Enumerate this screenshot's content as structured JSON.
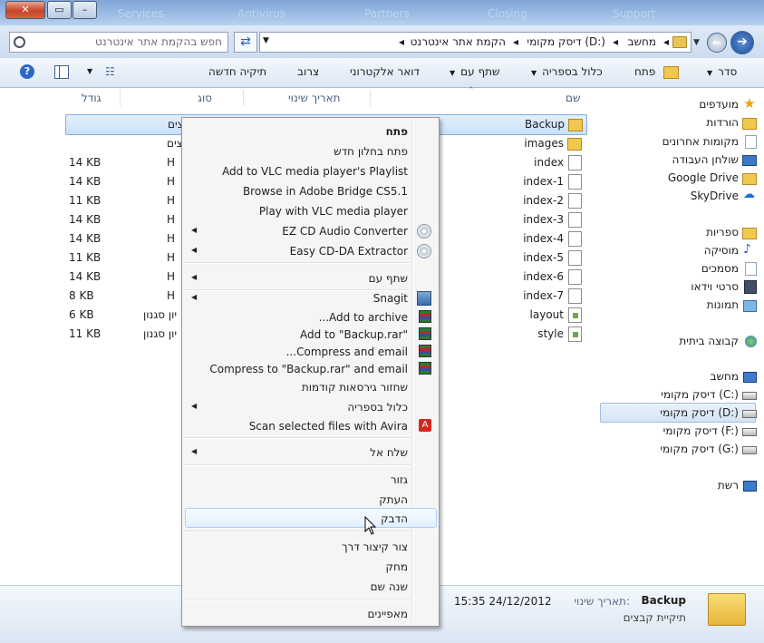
{
  "titlebar": {
    "ghost_tabs": [
      "Services",
      "Antivirus",
      "Partners",
      "Closing",
      "Support"
    ]
  },
  "nav": {
    "breadcrumbs": [
      "מחשב",
      "דיסק מקומי (D:)",
      "הקמת אתר אינטרנט"
    ],
    "search_placeholder": "חפש בהקמת אתר אינטרנט"
  },
  "toolbar": {
    "organize": "סדר",
    "open": "פתח",
    "include_library": "כלול בספריה",
    "share_with": "שתף עם",
    "email": "דואר אלקטרוני",
    "burn": "צרוב",
    "new_folder": "תיקיה חדשה"
  },
  "columns": {
    "name": "שם",
    "date_modified": "תאריך שינוי",
    "type": "סוג",
    "size": "גודל"
  },
  "files": [
    {
      "name": "Backup",
      "icon": "folder",
      "type": "צים",
      "size": ""
    },
    {
      "name": "images",
      "icon": "folder",
      "type": "צים",
      "size": ""
    },
    {
      "name": "index",
      "icon": "file",
      "type": "H",
      "size": "14 KB"
    },
    {
      "name": "index-1",
      "icon": "file",
      "type": "H",
      "size": "14 KB"
    },
    {
      "name": "index-2",
      "icon": "file",
      "type": "H",
      "size": "11 KB"
    },
    {
      "name": "index-3",
      "icon": "file",
      "type": "H",
      "size": "14 KB"
    },
    {
      "name": "index-4",
      "icon": "file",
      "type": "H",
      "size": "14 KB"
    },
    {
      "name": "index-5",
      "icon": "file",
      "type": "H",
      "size": "11 KB"
    },
    {
      "name": "index-6",
      "icon": "file",
      "type": "H",
      "size": "14 KB"
    },
    {
      "name": "index-7",
      "icon": "file",
      "type": "H",
      "size": "8 KB"
    },
    {
      "name": "layout",
      "icon": "css",
      "type": "יון סגנון",
      "size": "6 KB"
    },
    {
      "name": "style",
      "icon": "css",
      "type": "יון סגנון",
      "size": "11 KB"
    }
  ],
  "navpane": {
    "favorites": "מועדפים",
    "downloads": "הורדות",
    "recent_places": "מקומות אחרונים",
    "desktop": "שולחן העבודה",
    "google_drive": "Google Drive",
    "skydrive": "SkyDrive",
    "libraries": "ספריות",
    "music": "מוסיקה",
    "documents": "מסמכים",
    "videos": "סרטי וידאו",
    "pictures": "תמונות",
    "homegroup": "קבוצה ביתית",
    "computer": "מחשב",
    "drive_c": "דיסק מקומי (C:)",
    "drive_d": "דיסק מקומי (D:)",
    "drive_f": "דיסק מקומי (F:)",
    "drive_g": "דיסק מקומי (G:)",
    "network": "רשת"
  },
  "details": {
    "name": "Backup",
    "kind": "תיקיית קבצים",
    "modified_label": "תאריך שינוי:",
    "modified_value": "15:35 24/12/2012"
  },
  "context_menu": {
    "open": "פתח",
    "open_new_window": "פתח בחלון חדש",
    "vlc_playlist": "Add to VLC media player's Playlist",
    "adobe_bridge": "Browse in Adobe Bridge CS5.1",
    "vlc_play": "Play with VLC media player",
    "ez_cd": "EZ CD Audio Converter",
    "easy_cd": "Easy CD-DA Extractor",
    "share_with": "שתף עם",
    "snagit": "Snagit",
    "add_archive": "...Add to archive",
    "add_backup_rar": "Add to \"Backup.rar\"",
    "compress_email": "...Compress and email",
    "compress_backup_email": "Compress to \"Backup.rar\" and email",
    "restore_versions": "שחזור גירסאות קודמות",
    "include_library": "כלול בספריה",
    "avira": "Scan selected files with Avira",
    "send_to": "שלח אל",
    "cut": "גזור",
    "copy": "העתק",
    "paste": "הדבק",
    "shortcut": "צור קיצור דרך",
    "delete": "מחק",
    "rename": "שנה שם",
    "properties": "מאפיינים"
  }
}
